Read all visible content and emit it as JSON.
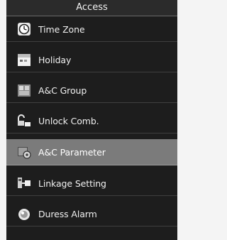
{
  "title": "Access",
  "menu": {
    "items": [
      {
        "label": "Time Zone",
        "icon": "clock-icon"
      },
      {
        "label": "Holiday",
        "icon": "calendar-icon"
      },
      {
        "label": "A&C Group",
        "icon": "group-icon"
      },
      {
        "label": "Unlock Comb.",
        "icon": "unlock-icon"
      },
      {
        "label": "A&C Parameter",
        "icon": "parameter-icon"
      },
      {
        "label": "Linkage Setting",
        "icon": "linkage-icon"
      },
      {
        "label": "Duress Alarm",
        "icon": "alarm-icon"
      }
    ],
    "selected_index": 4
  },
  "colors": {
    "background": "#1d1d1d",
    "selected": "#7b7b7b",
    "text": "#f0f0f0"
  }
}
